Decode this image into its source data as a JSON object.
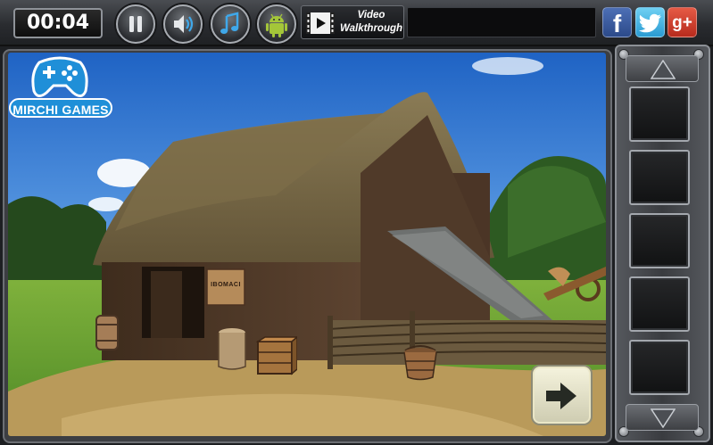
{
  "topbar": {
    "timer": "00:04",
    "walkthrough_line1": "Video",
    "walkthrough_line2": "Walkthrough",
    "facebook_label": "f",
    "gplus_label": "g+"
  },
  "icons": {
    "pause": "pause-icon",
    "sound": "speaker-icon",
    "music": "music-note-icon",
    "android": "android-icon",
    "video": "film-play-icon",
    "next": "arrow-right-icon",
    "inventory_up": "arrow-up-icon",
    "inventory_down": "arrow-down-icon"
  },
  "logo": {
    "brand": "MIRCHI GAMES"
  },
  "scene": {
    "sign_text": "IBOMACI"
  },
  "inventory": {
    "slots": [
      "",
      "",
      "",
      "",
      ""
    ]
  },
  "colors": {
    "facebook": "#3b5998",
    "twitter": "#3fb5e8",
    "gplus": "#d3432f",
    "logo_blue": "#1f8fd8"
  }
}
